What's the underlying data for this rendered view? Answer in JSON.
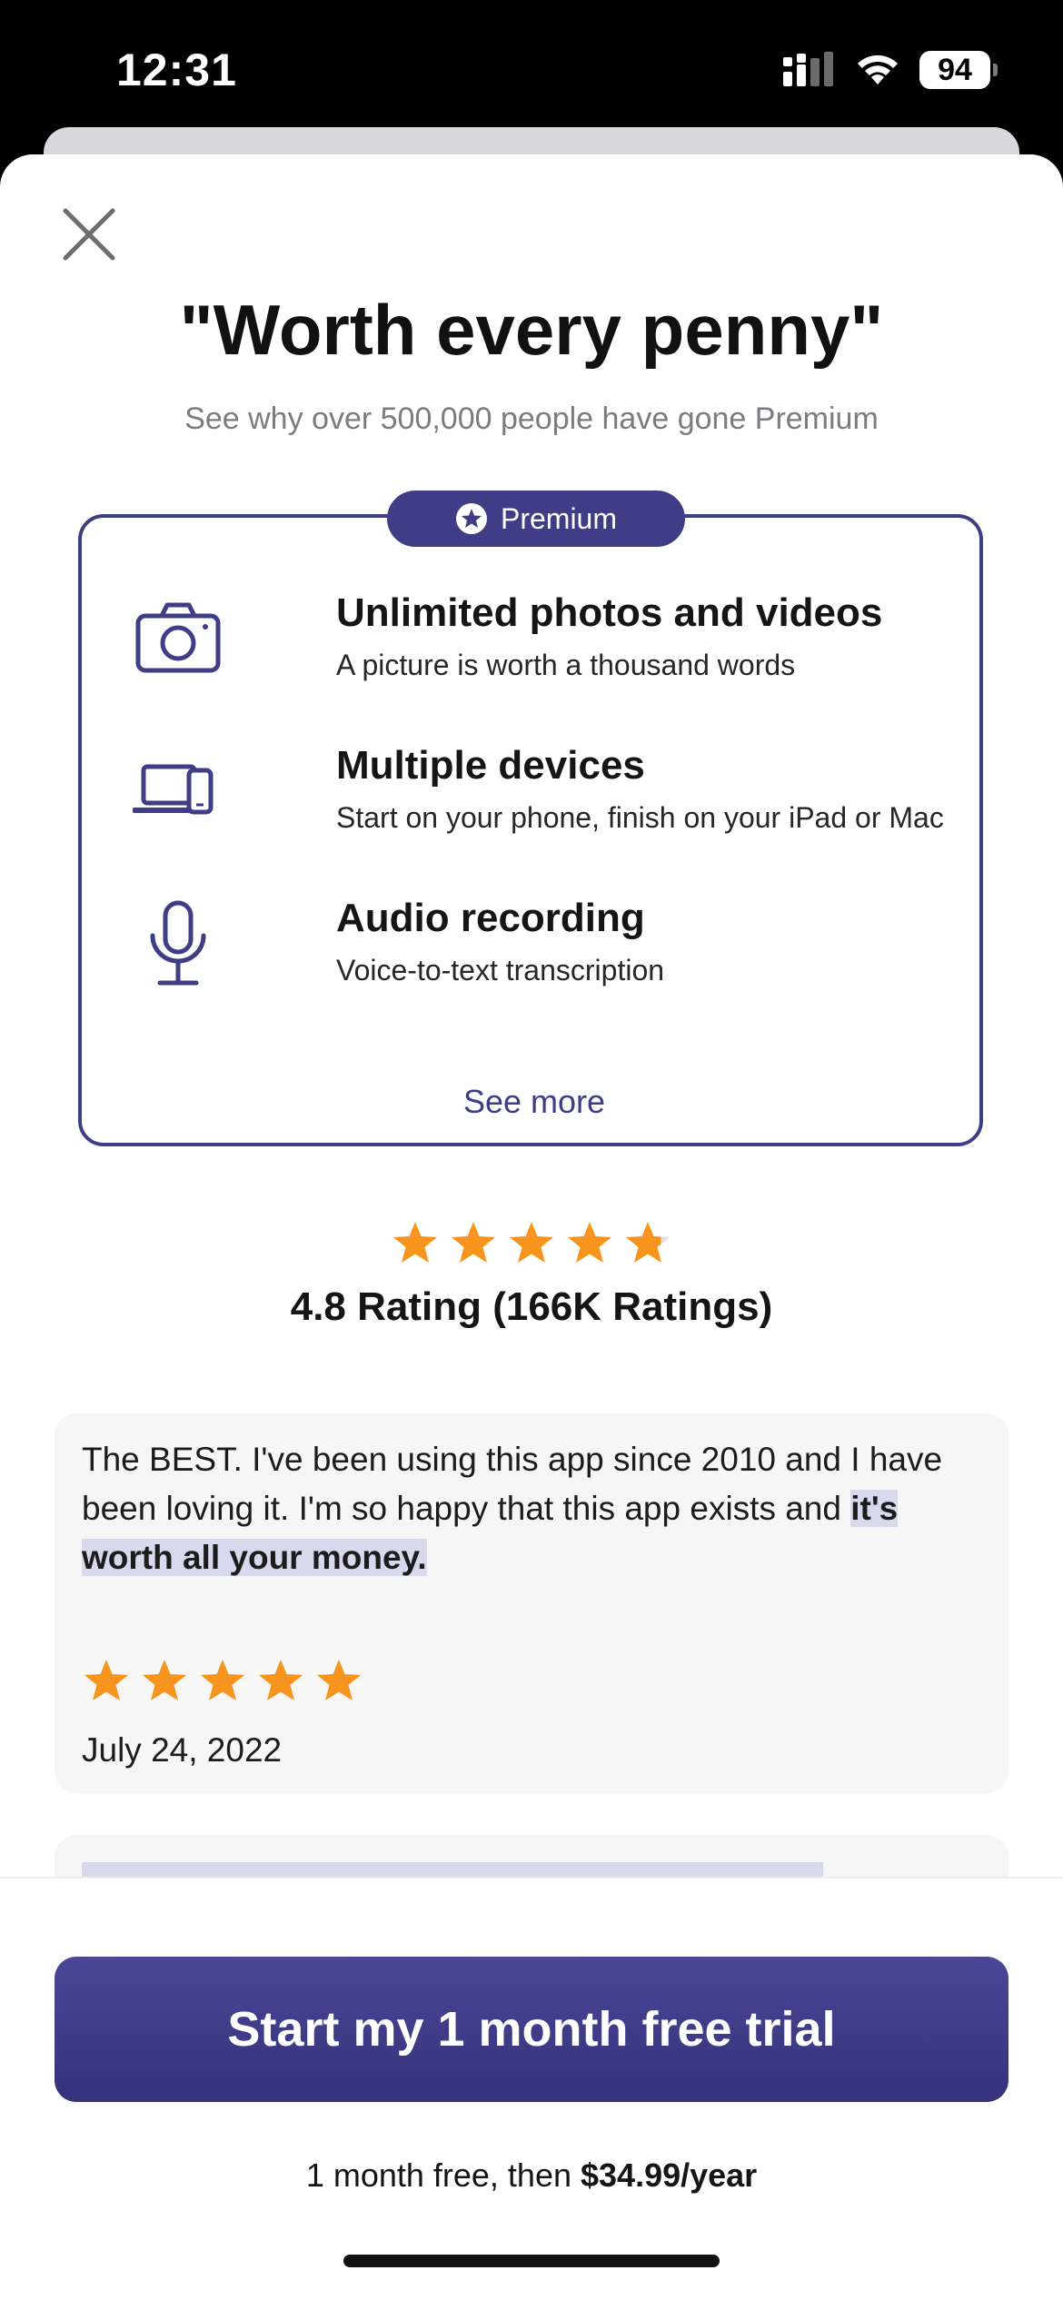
{
  "status_bar": {
    "time": "12:31",
    "battery": "94",
    "icons": [
      "cellular-signal-icon",
      "wifi-icon",
      "battery-icon"
    ]
  },
  "modal": {
    "close_icon": "close-icon",
    "title": "\"Worth every penny\"",
    "subtitle": "See why over 500,000 people have gone Premium"
  },
  "premium_card": {
    "badge_label": "Premium",
    "badge_icon": "star-circle-icon",
    "features": [
      {
        "icon": "camera-icon",
        "title": "Unlimited photos and videos",
        "description": "A picture is worth a thousand words"
      },
      {
        "icon": "devices-icon",
        "title": "Multiple devices",
        "description": "Start on your phone, finish on your iPad or Mac"
      },
      {
        "icon": "microphone-icon",
        "title": "Audio recording",
        "description": "Voice-to-text transcription"
      }
    ],
    "see_more_label": "See more"
  },
  "rating": {
    "stars": 4.8,
    "text": "4.8 Rating (166K Ratings)"
  },
  "review": {
    "text_plain": "The BEST. I've been using this app since 2010 and I have been loving it. I'm so happy that this app exists and ",
    "text_highlight": "it's worth all your money.",
    "stars": 5,
    "date": "July 24, 2022"
  },
  "cta": {
    "button_label": "Start my 1 month free trial",
    "price_prefix": "1 month free, then ",
    "price_value": "$34.99/year"
  },
  "colors": {
    "accent": "#3f3d85",
    "star": "#f7941d",
    "highlight": "#d9d9ee"
  }
}
